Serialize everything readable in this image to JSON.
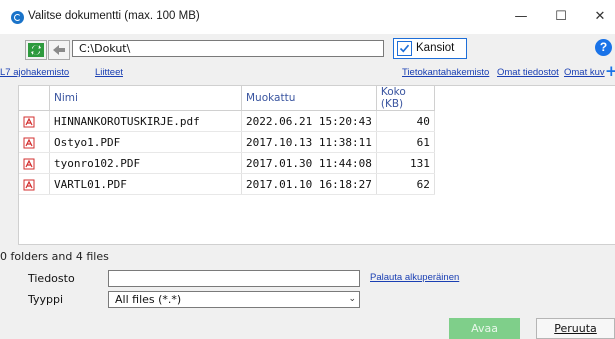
{
  "window": {
    "title": "Valitse dokumentti (max. 100 MB)",
    "minimize": "—",
    "maximize": "☐",
    "close": "✕"
  },
  "toolbar": {
    "path": "C:\\Dokut\\",
    "folders_label": "Kansiot",
    "folders_checked": true,
    "help": "?"
  },
  "links": {
    "l7": "L7 ajohakemisto",
    "attachments": "Liitteet",
    "db_directory": "Tietokantahakemisto",
    "own_files": "Omat tiedostot",
    "own_images": "Omat kuv"
  },
  "table": {
    "columns": [
      "Nimi",
      "Muokattu",
      "Koko (KB)"
    ],
    "rows": [
      {
        "name": "HINNANKOROTUSKIRJE.pdf",
        "modified": "2022.06.21 15:20:43",
        "size": "40"
      },
      {
        "name": "Ostyo1.PDF",
        "modified": "2017.10.13 11:38:11",
        "size": "61"
      },
      {
        "name": "tyonro102.PDF",
        "modified": "2017.01.30 11:44:08",
        "size": "131"
      },
      {
        "name": "VARTL01.PDF",
        "modified": "2017.01.10 16:18:27",
        "size": "62"
      }
    ]
  },
  "status": "0 folders and 4 files",
  "form": {
    "file_label": "Tiedosto",
    "file_value": "",
    "type_label": "Tyyppi",
    "type_value": "All files (*.*)",
    "restore_link": "Palauta alkuperäinen"
  },
  "buttons": {
    "open": "Avaa",
    "cancel": "Peruuta"
  },
  "colors": {
    "accent": "#1e6ed8",
    "open_button": "#7fcf8a",
    "pdf_icon": "#d32f2f",
    "link": "#1a3fb3"
  }
}
